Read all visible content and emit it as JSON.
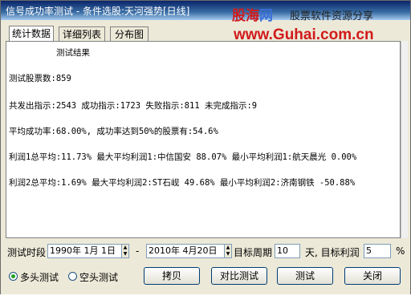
{
  "window": {
    "title": "信号成功率测试 - 条件选股:天河强势[日线]"
  },
  "watermark": {
    "logo_cn": "股海",
    "logo_net": "网",
    "slogan": "股票软件资源分享",
    "url": "www.Guhai.com.cn"
  },
  "tabs": [
    {
      "label": "统计数据",
      "active": true
    },
    {
      "label": "详细列表",
      "active": false
    },
    {
      "label": "分布图",
      "active": false
    }
  ],
  "results": {
    "heading": "测试结果",
    "stock_count": "测试股票数:859",
    "signals": "共发出指示:2543 成功指示:1723 失败指示:811 未完成指示:9",
    "success_rate": "平均成功率:68.00%, 成功率达到50%的股票有:54.6%",
    "profit1": "利润1总平均:11.73% 最大平均利润1:中信国安 88.07% 最小平均利润1:航天晨光 0.00%",
    "profit2": "利润2总平均:1.69% 最大平均利润2:ST石岘   49.68% 最小平均利润2:济南钢铁 -50.88%"
  },
  "controls": {
    "period_label": "测试时段",
    "start_date": "1990年 1月 1日",
    "dash": "-",
    "end_date": "2010年 4月20日",
    "target_period_label": "目标周期",
    "target_period_value": "10",
    "target_profit_label": "天, 目标利润",
    "target_profit_value": "5",
    "percent": "%",
    "radio_long": "多头测试",
    "radio_short": "空头测试",
    "btn_copy": "拷贝",
    "btn_compare": "对比测试",
    "btn_test": "测试",
    "btn_close": "关闭"
  }
}
